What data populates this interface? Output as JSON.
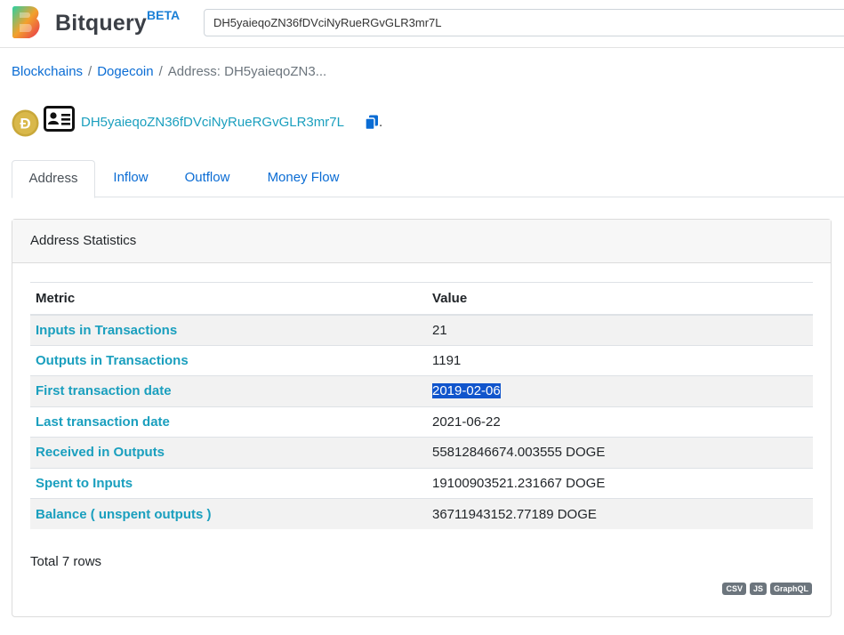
{
  "header": {
    "brand": "Bitquery",
    "beta": "BETA",
    "search_value": "DH5yaieqoZN36fDVciNyRueRGvGLR3mr7L"
  },
  "breadcrumb": {
    "items": [
      "Blockchains",
      "Dogecoin"
    ],
    "current": "Address: DH5yaieqoZN3..."
  },
  "address": {
    "value": "DH5yaieqoZN36fDVciNyRueRGvGLR3mr7L",
    "trailing": "."
  },
  "tabs": [
    {
      "label": "Address",
      "active": true
    },
    {
      "label": "Inflow",
      "active": false
    },
    {
      "label": "Outflow",
      "active": false
    },
    {
      "label": "Money Flow",
      "active": false
    }
  ],
  "card": {
    "title": "Address Statistics",
    "columns": [
      "Metric",
      "Value"
    ],
    "rows": [
      {
        "metric": "Inputs in Transactions",
        "value": "21"
      },
      {
        "metric": "Outputs in Transactions",
        "value": "1191"
      },
      {
        "metric": "First transaction date",
        "value": "2019-02-06"
      },
      {
        "metric": "Last transaction date",
        "value": "2021-06-22"
      },
      {
        "metric": "Received in Outputs",
        "value": "55812846674.003555 DOGE"
      },
      {
        "metric": "Spent to Inputs",
        "value": "19100903521.231667 DOGE"
      },
      {
        "metric": "Balance ( unspent outputs )",
        "value": "36711943152.77189 DOGE"
      }
    ],
    "total": "Total 7 rows",
    "export_badges": [
      "CSV",
      "JS",
      "GraphQL"
    ]
  },
  "colors": {
    "link": "#0a6cd4",
    "metric": "#1a9fbe",
    "selection": "#1155cc",
    "doge_gold": "#c9a83a"
  },
  "icons": [
    "bitquery-logo",
    "dogecoin-icon",
    "address-card-icon",
    "copy-icon"
  ]
}
